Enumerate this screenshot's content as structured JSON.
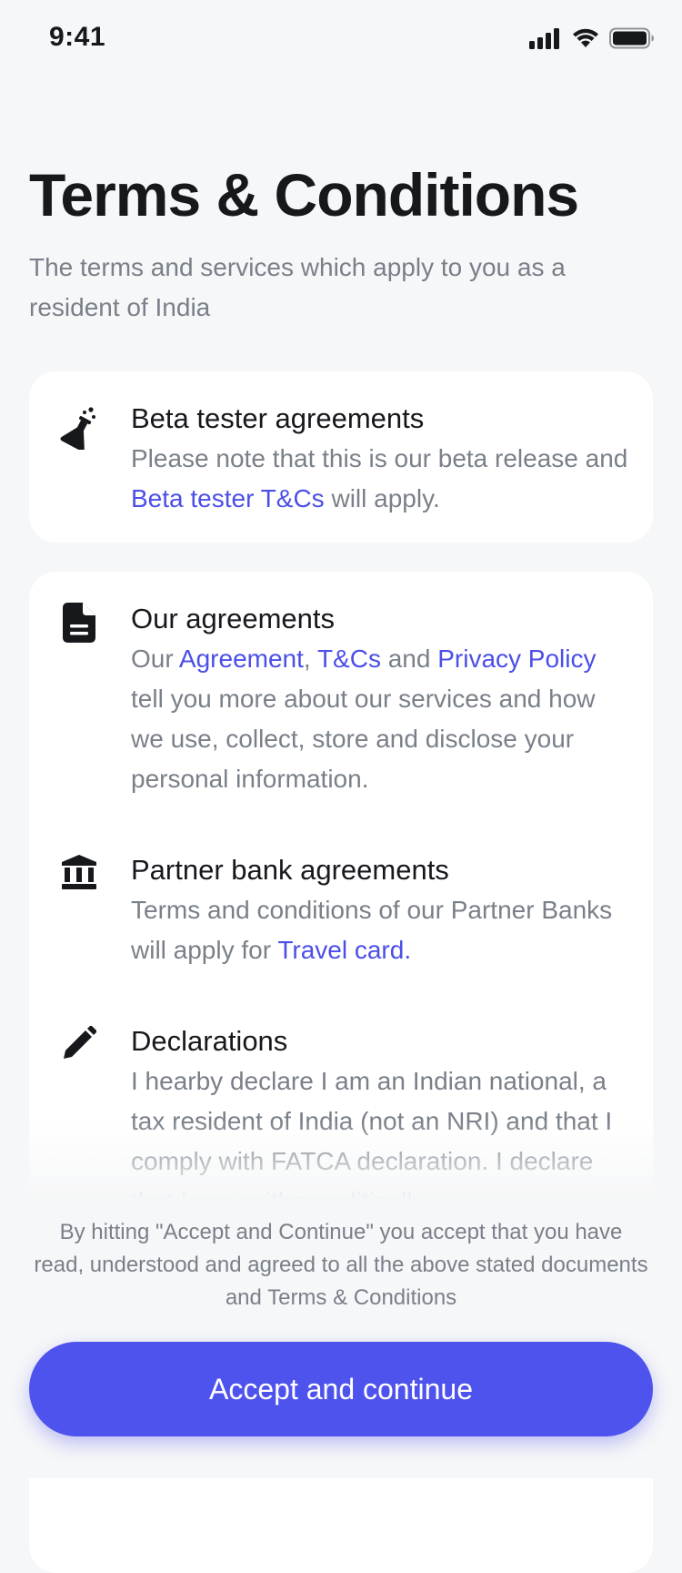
{
  "status_bar": {
    "time": "9:41"
  },
  "header": {
    "title": "Terms & Conditions",
    "subtitle": "The terms and services which apply to you as a resident of India"
  },
  "beta": {
    "title": "Beta tester agreements",
    "text_1": "Please note that this is our beta release and ",
    "link": "Beta tester T&Cs",
    "text_2": " will apply."
  },
  "agreements": {
    "title": "Our agreements",
    "text_1": "Our ",
    "link_agreement": "Agreement",
    "sep": ", ",
    "link_tcs": "T&Cs",
    "and": " and ",
    "link_privacy": "Privacy Policy",
    "text_2": " tell you more about our services and how we use, collect, store and disclose your personal information."
  },
  "partner": {
    "title": "Partner bank agreements",
    "text_1": "Terms and conditions of our Partner Banks will apply for ",
    "link": "Travel card."
  },
  "declarations": {
    "title": "Declarations",
    "text": "I hearby declare I am an Indian national, a tax resident of India (not an NRI) and that I comply with FATCA declaration. I declare that I am neither politically"
  },
  "footer": {
    "note": "By hitting \"Accept and Continue\" you accept that you have read, understood and agreed to all the above stated documents and Terms & Conditions",
    "button_label": "Accept and continue"
  },
  "colors": {
    "accent": "#4f53ee",
    "link": "#4b4fe6",
    "muted_text": "#7a8089",
    "background": "#f6f7f8"
  },
  "icons": [
    "cellular-signal-icon",
    "wifi-icon",
    "battery-icon",
    "flask-icon",
    "document-icon",
    "bank-icon",
    "pencil-icon"
  ]
}
